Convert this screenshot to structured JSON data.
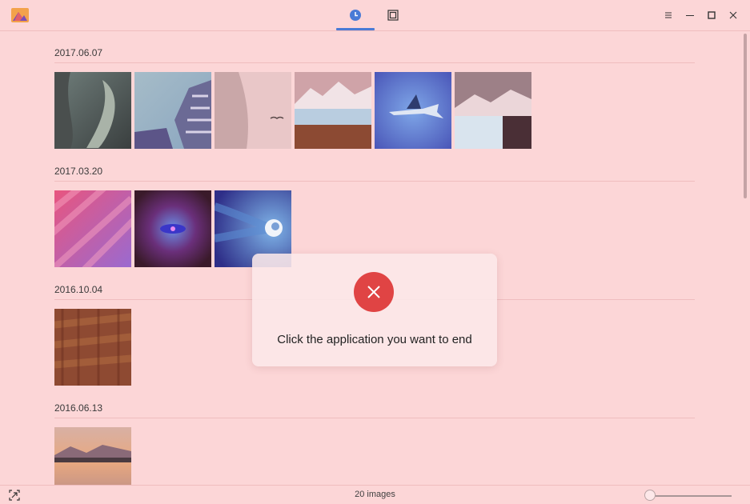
{
  "header": {
    "tabs": [
      {
        "name": "timeline",
        "icon": "clock-icon",
        "active": true
      },
      {
        "name": "albums",
        "icon": "album-icon",
        "active": false
      }
    ],
    "accent_color": "#4a7bd6"
  },
  "groups": [
    {
      "date": "2017.06.07"
    },
    {
      "date": "2017.03.20"
    },
    {
      "date": "2016.10.04"
    },
    {
      "date": "2016.06.13"
    }
  ],
  "status": {
    "count": "20 images",
    "zoom_level": 0
  },
  "toast": {
    "message": "Click the application you want to end",
    "icon": "close-icon",
    "icon_color": "#e04444"
  }
}
